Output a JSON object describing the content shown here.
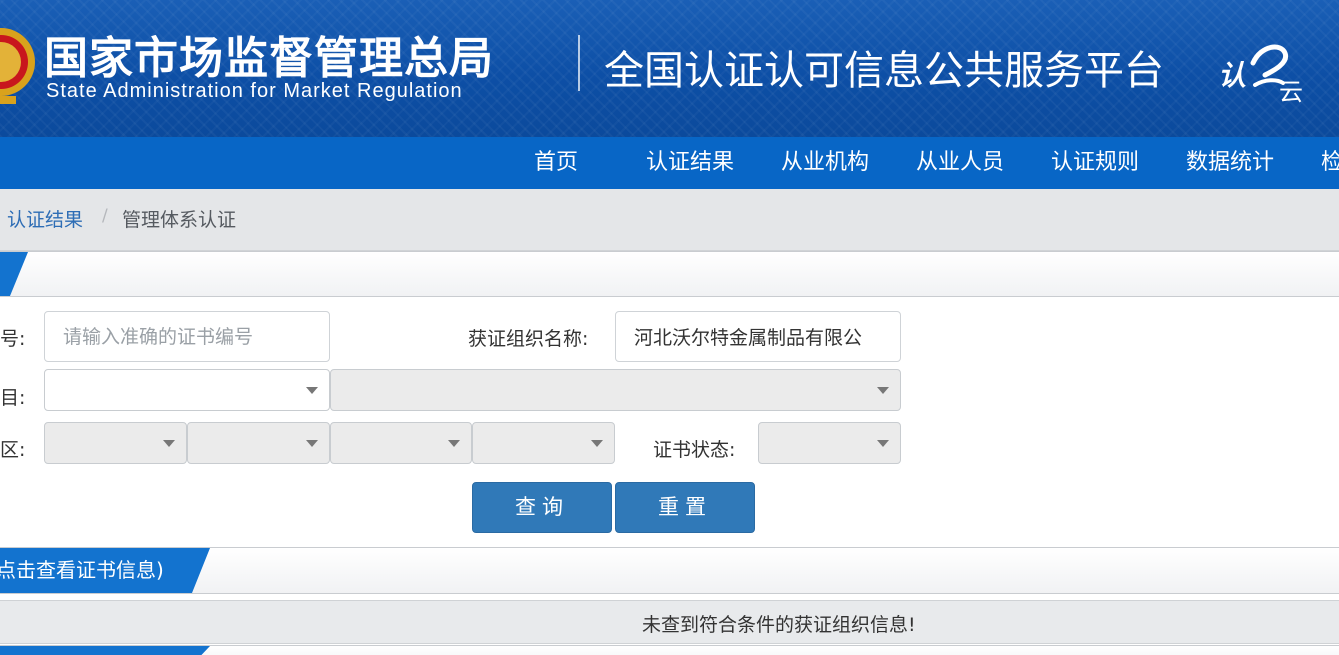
{
  "header": {
    "org_name_cn": "国家市场监督管理总局",
    "org_name_en": "State Administration  for  Market Regulation",
    "platform_title": "全国认证认可信息公共服务平台",
    "cloud_logo_main": "认",
    "cloud_logo_sub": "云"
  },
  "nav": {
    "items": [
      "首页",
      "认证结果",
      "从业机构",
      "从业人员",
      "认证规则",
      "数据统计",
      "检"
    ]
  },
  "breadcrumb": {
    "parent": "认证结果",
    "separator": "/",
    "current": "管理体系认证"
  },
  "form": {
    "cert_no_label": "号:",
    "cert_no_placeholder": "请输入准确的证书编号",
    "cert_no_value": "",
    "org_name_label": "获证组织名称:",
    "org_name_value": "河北沃尔特金属制品有限公",
    "project_label": "目:",
    "region_label": "区:",
    "cert_status_label": "证书状态:",
    "query_button": "查询",
    "reset_button": "重置"
  },
  "results": {
    "section_title": "点击查看证书信息)",
    "no_result_message": "未查到符合条件的获证组织信息!"
  },
  "colors": {
    "header_blue": "#0d4fa6",
    "nav_blue": "#0866c6",
    "accent_blue": "#1373cf",
    "button_blue": "#3079b8"
  }
}
